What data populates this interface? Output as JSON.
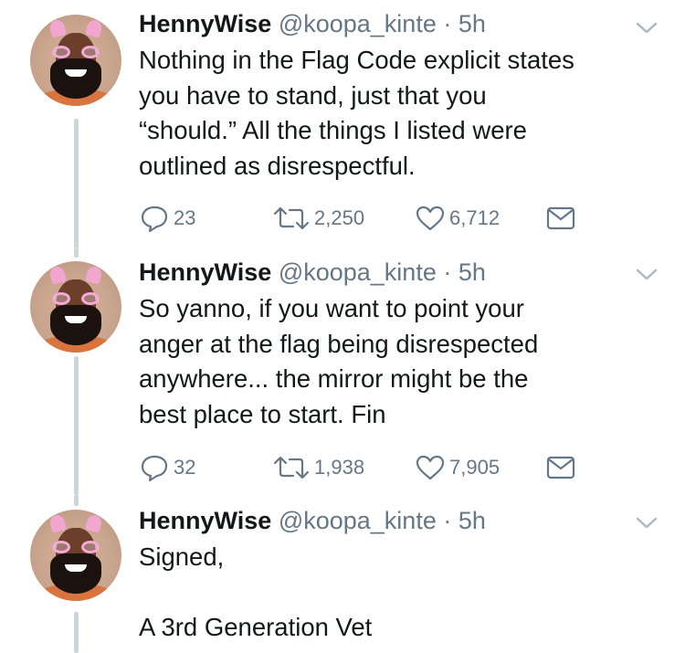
{
  "tweets": [
    {
      "name": "HennyWise",
      "handle": "@koopa_kinte",
      "separator": "·",
      "time": "5h",
      "text": "Nothing in the Flag Code explicit states\nyou have to stand, just that you\n“should.” All the things I listed were\noutlined as disrespectful.",
      "replies": "23",
      "retweets": "2,250",
      "likes": "6,712"
    },
    {
      "name": "HennyWise",
      "handle": "@koopa_kinte",
      "separator": "·",
      "time": "5h",
      "text": "So yanno, if you want to point your\nanger at the flag being disrespected\nanywhere... the mirror might be the\nbest place to start. Fin",
      "replies": "32",
      "retweets": "1,938",
      "likes": "7,905"
    },
    {
      "name": "HennyWise",
      "handle": "@koopa_kinte",
      "separator": "·",
      "time": "5h",
      "text": "Signed,\n\nA 3rd Generation Vet"
    }
  ],
  "icons": {
    "reply": "reply-icon",
    "retweet": "retweet-icon",
    "like": "heart-icon",
    "dm": "envelope-icon",
    "menu": "chevron-down-icon"
  },
  "colors": {
    "text": "#14171a",
    "muted": "#657786",
    "thread_line": "#ccd6dd"
  }
}
